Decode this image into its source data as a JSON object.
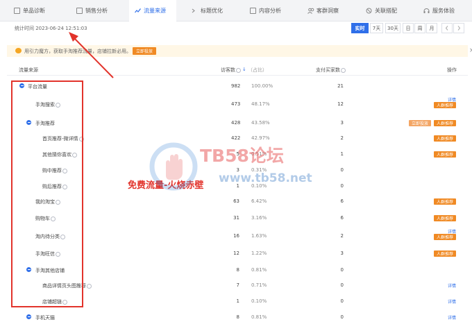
{
  "tabs": [
    {
      "label": "单品诊断",
      "icon": "diagnosis-icon"
    },
    {
      "label": "销售分析",
      "icon": "sales-icon"
    },
    {
      "label": "流量来源",
      "icon": "traffic-icon",
      "active": true
    },
    {
      "label": "标题优化",
      "icon": "title-icon"
    },
    {
      "label": "内容分析",
      "icon": "content-icon"
    },
    {
      "label": "客群洞察",
      "icon": "audience-icon"
    },
    {
      "label": "关联搭配",
      "icon": "match-icon"
    },
    {
      "label": "服务体验",
      "icon": "service-icon"
    }
  ],
  "stats": {
    "time_text": "统计时间 2023-06-24 12:51:03"
  },
  "ranges": [
    "实时",
    "7天",
    "30天",
    "日",
    "周",
    "月"
  ],
  "notice": {
    "text": "用引力魔方，获取手淘推荐流量，店铺拉新必用。",
    "button": "立即投放",
    "close": "×"
  },
  "table": {
    "headers": {
      "source": "流量来源",
      "visitors": "访客数",
      "ratio": "（占比）",
      "buyers": "支付买家数",
      "action": "操作"
    },
    "rows": [
      {
        "name": "平台流量",
        "visitors": "982",
        "pct": "100.00%",
        "buyers": "21"
      },
      {
        "name": "手淘搜索",
        "visitors": "473",
        "pct": "48.17%",
        "buyers": "12",
        "detail": "详情",
        "tag": "人群推荐"
      },
      {
        "name": "手淘推荐",
        "visitors": "428",
        "pct": "43.58%",
        "buyers": "3",
        "extra": "立即投放",
        "tag": "人群推荐"
      },
      {
        "name": "首页推荐-微详情",
        "visitors": "422",
        "pct": "42.97%",
        "buyers": "2",
        "tag": "人群推荐"
      },
      {
        "name": "其他猜你喜欢",
        "visitors": "5",
        "pct": "0.51%",
        "buyers": "1",
        "tag": "人群推荐"
      },
      {
        "name": "购中推荐",
        "visitors": "3",
        "pct": "0.31%",
        "buyers": "0"
      },
      {
        "name": "购后推荐",
        "visitors": "1",
        "pct": "0.10%",
        "buyers": "0"
      },
      {
        "name": "我的淘宝",
        "visitors": "63",
        "pct": "6.42%",
        "buyers": "6",
        "tag": "人群推荐"
      },
      {
        "name": "购物车",
        "visitors": "31",
        "pct": "3.16%",
        "buyers": "6",
        "tag": "人群推荐"
      },
      {
        "name": "淘内待分类",
        "visitors": "16",
        "pct": "1.63%",
        "buyers": "2",
        "detail": "详情",
        "tag": "人群推荐"
      },
      {
        "name": "手淘旺信",
        "visitors": "12",
        "pct": "1.22%",
        "buyers": "3",
        "tag": "人群推荐"
      },
      {
        "name": "手淘其他店铺",
        "visitors": "8",
        "pct": "0.81%",
        "buyers": "0"
      },
      {
        "name": "商品详情页头图推荐",
        "visitors": "7",
        "pct": "0.71%",
        "buyers": "0",
        "detail": "详情"
      },
      {
        "name": "店铺超链",
        "visitors": "1",
        "pct": "0.10%",
        "buyers": "0",
        "detail": "详情"
      },
      {
        "name": "手机天猫",
        "visitors": "8",
        "pct": "0.81%",
        "buyers": "0",
        "detail": "详情"
      }
    ]
  },
  "annotation": {
    "caption": "免费流量-火烧赤壁"
  },
  "watermark": {
    "title": "TB58论坛",
    "url": "www.tb58.net"
  },
  "colors": {
    "accent": "#2f6fe9",
    "orange": "#f08a24",
    "annotation_red": "#e2332b"
  }
}
